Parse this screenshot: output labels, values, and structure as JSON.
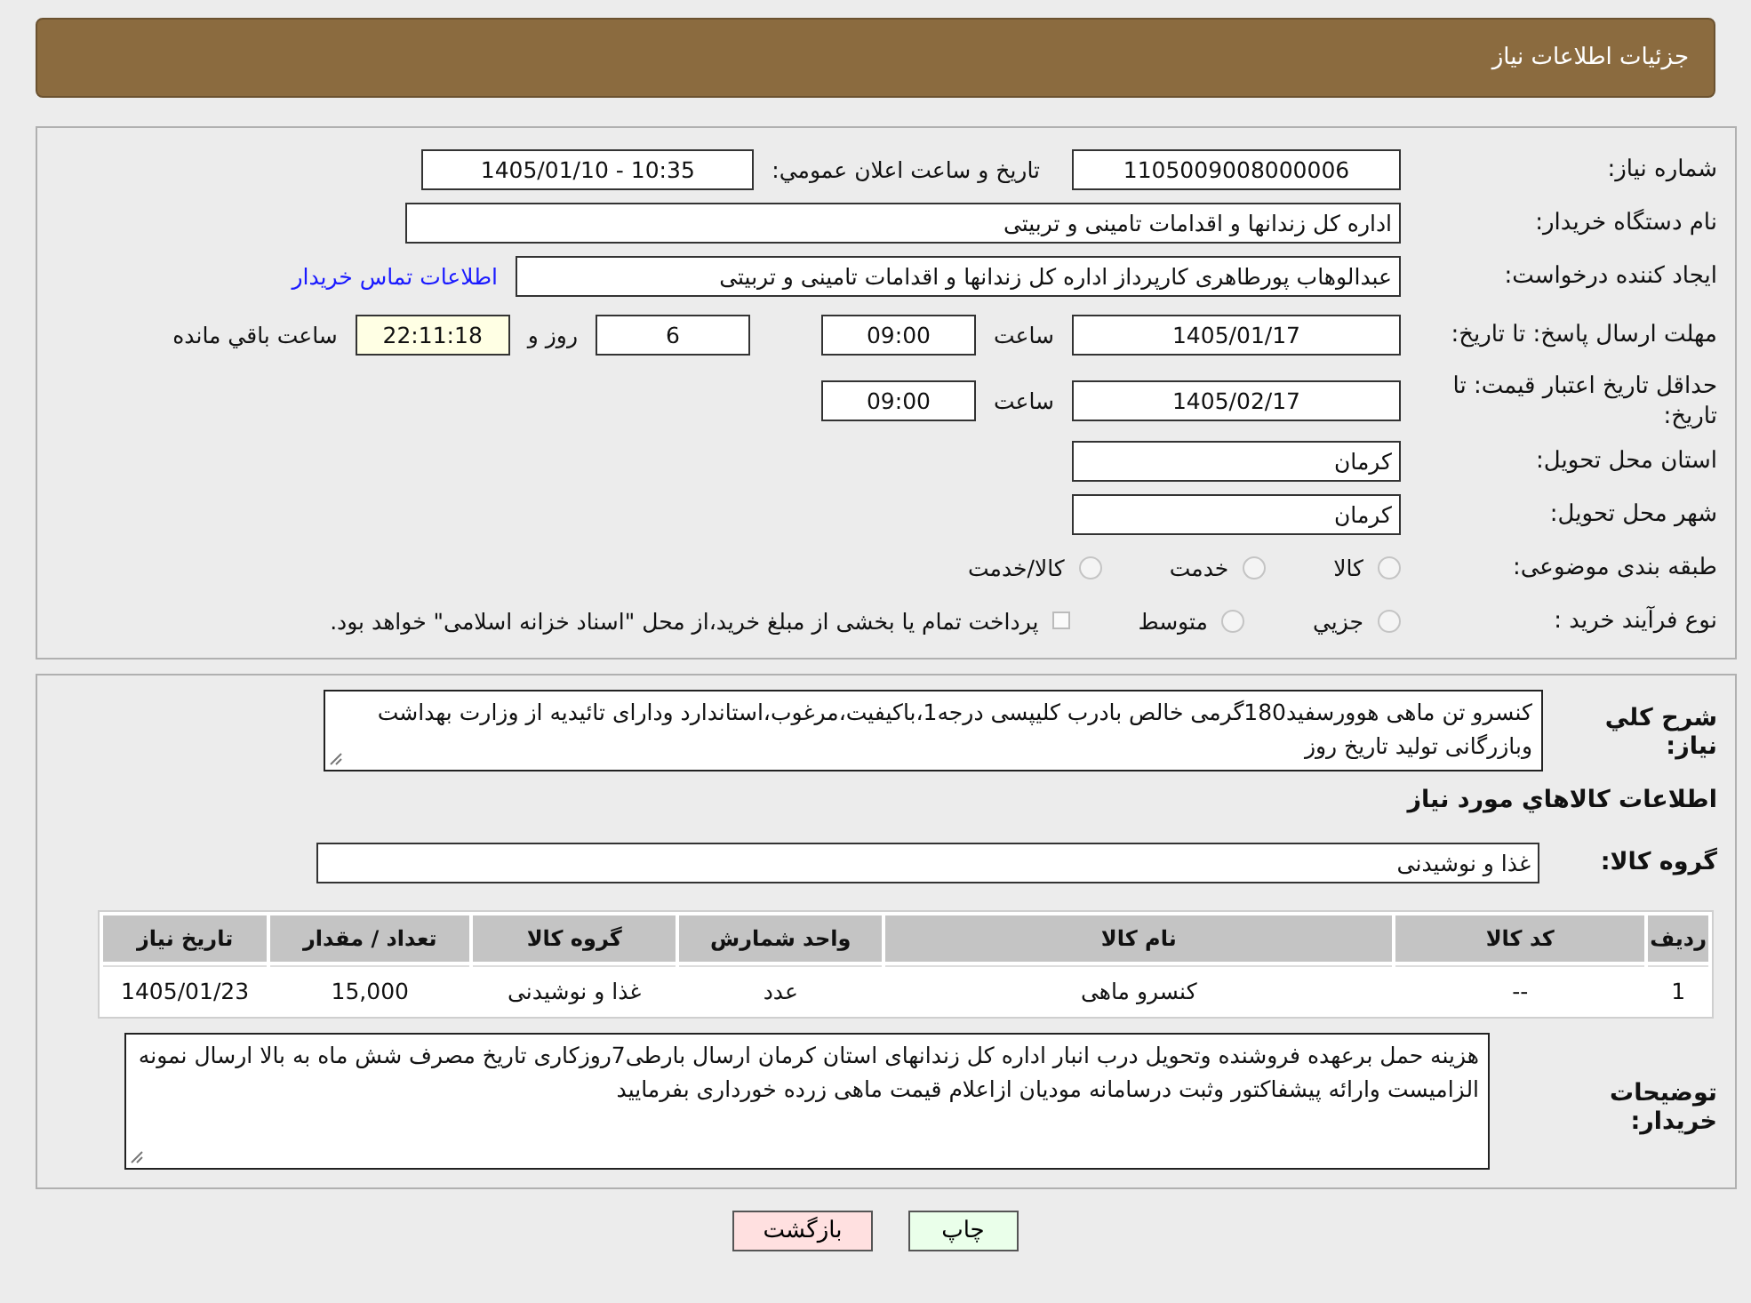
{
  "header": {
    "title": "جزئیات اطلاعات نیاز"
  },
  "need_number": {
    "label": "شماره نیاز:",
    "value": "1105009008000006"
  },
  "announce": {
    "label": "تاریخ و ساعت اعلان عمومي:",
    "value": "1405/01/10 - 10:35"
  },
  "buyer": {
    "label": "نام دستگاه خریدار:",
    "value": "اداره کل زندانها و اقدامات تامینی و تربیتی"
  },
  "requester": {
    "label": "ایجاد کننده درخواست:",
    "value": "عبدالوهاب پورطاهری کارپرداز اداره کل زندانها و اقدامات تامینی و تربیتی",
    "link": "اطلاعات تماس خریدار"
  },
  "deadline": {
    "label": "مهلت ارسال پاسخ: تا تاریخ:",
    "date": "1405/01/17",
    "time_label": "ساعت",
    "time": "09:00",
    "days": "6",
    "days_label": "روز و",
    "remaining": "22:11:18",
    "remaining_label": "ساعت باقي مانده"
  },
  "validity": {
    "label": "حداقل تاریخ اعتبار قیمت: تا تاریخ:",
    "date": "1405/02/17",
    "time_label": "ساعت",
    "time": "09:00"
  },
  "province": {
    "label": "استان محل تحویل:",
    "value": "کرمان"
  },
  "city": {
    "label": "شهر محل تحویل:",
    "value": "کرمان"
  },
  "category": {
    "label": "طبقه بندی موضوعی:",
    "options": [
      {
        "label": "کالا",
        "selected": false
      },
      {
        "label": "خدمت",
        "selected": false
      },
      {
        "label": "کالا/خدمت",
        "selected": false
      }
    ]
  },
  "purchase_type": {
    "label": "نوع فرآیند خرید :",
    "options": [
      {
        "label": "جزيي",
        "selected": false
      },
      {
        "label": "متوسط",
        "selected": false
      }
    ],
    "payment": {
      "checked": false,
      "text": "پرداخت تمام یا بخشی از مبلغ خرید،از محل \"اسناد خزانه اسلامی\" خواهد بود."
    }
  },
  "description": {
    "label": "شرح کلي نياز:",
    "value": "کنسرو تن ماهی هوورسفید180گرمی خالص بادرب کلیپسی درجه1،باکیفیت،مرغوب،استاندارد ودارای تائیدیه از وزارت بهداشت وبازرگانی تولید تاریخ روز"
  },
  "goods_heading": "اطلاعات کالاهاي مورد نياز",
  "goods_group": {
    "label": "گروه کالا:",
    "value": "غذا و نوشیدنی"
  },
  "table": {
    "columns": [
      "ردیف",
      "کد کالا",
      "نام کالا",
      "واحد شمارش",
      "گروه کالا",
      "تعداد / مقدار",
      "تاریخ نیاز"
    ],
    "rows": [
      [
        "1",
        "--",
        "کنسرو ماهی",
        "عدد",
        "غذا و نوشیدنی",
        "15,000",
        "1405/01/23"
      ]
    ]
  },
  "buyer_notes": {
    "label": "توضیحات خریدار:",
    "value": "هزینه حمل برعهده فروشنده وتحویل درب انبار اداره کل زندانهای استان کرمان ارسال بارطی7روزکاری تاریخ مصرف شش ماه به بالا ارسال نمونه الزامیست وارائه پیشفاکتور وثبت درسامانه مودیان ازاعلام قیمت ماهی زرده خورداری بفرمایید"
  },
  "buttons": [
    {
      "label": "چاپ",
      "kind": "print"
    },
    {
      "label": "بازگشت",
      "kind": "back"
    }
  ]
}
